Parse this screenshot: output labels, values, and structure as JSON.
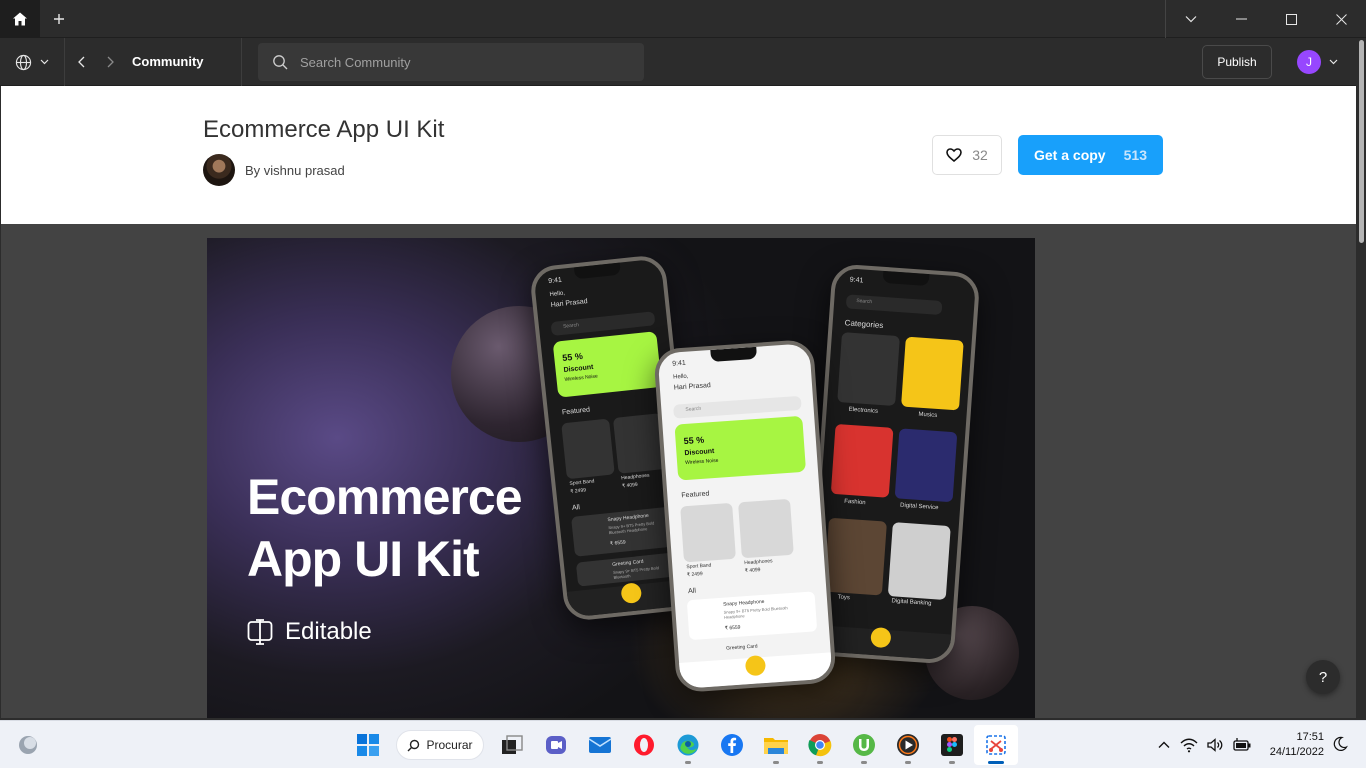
{
  "titlebar": {
    "home_icon": "home-icon",
    "add_tab_icon": "plus-icon",
    "controls": [
      "chevron-down-icon",
      "minimize-icon",
      "maximize-icon",
      "close-icon"
    ]
  },
  "toolbar": {
    "breadcrumb": "Community",
    "search_placeholder": "Search Community",
    "publish_label": "Publish",
    "avatar_initial": "J"
  },
  "file": {
    "title": "Ecommerce App UI Kit",
    "author": "By vishnu prasad",
    "likes": "32",
    "copy_label": "Get a copy",
    "copy_count": "513"
  },
  "hero": {
    "title_line1": "Ecommerce",
    "title_line2": "App UI Kit",
    "editable_label": "Editable",
    "phone1": {
      "time": "9:41",
      "greeting": "Hello,",
      "name": "Hari Prasad",
      "search": "Search",
      "discount_pct": "55 %",
      "discount_label": "Discount",
      "discount_sub": "Wireless Noise",
      "featured": "Featured",
      "item1": "Sport Band",
      "item1_price": "₹ 2499",
      "item2": "Headphones",
      "item2_price": "₹ 4099",
      "all": "All",
      "list1": "Snapy Headphone",
      "list1_desc": "Snapy 9+ BT5 Pretty Bold Bluetooth Headphone",
      "list1_price": "₹ 6559",
      "list2": "Greeting Card",
      "list2_desc": "Snapy 9+ BT5 Pretty Bold Bluetooth"
    },
    "phone2": {
      "time": "9:41",
      "greeting": "Hello,",
      "name": "Hari Prasad",
      "search": "Search",
      "discount_pct": "55 %",
      "discount_label": "Discount",
      "discount_sub": "Wireless Noise",
      "featured": "Featured",
      "item1": "Sport Band",
      "item1_price": "₹ 2499",
      "item2": "Headphones",
      "item2_price": "₹ 4099",
      "all": "All",
      "list1": "Snapy Headphone",
      "list1_desc": "Snapy 9+ BT5 Pretty Bold Bluetooth Headphone",
      "list1_price": "₹ 6559",
      "list2": "Greeting Card"
    },
    "phone3": {
      "time": "9:41",
      "search": "Search",
      "categories": "Categories",
      "cat1": "Electronics",
      "cat2": "Musics",
      "cat3": "Fashion",
      "cat4": "Digital Service",
      "cat5": "Toys",
      "cat6": "Digital Banking"
    }
  },
  "help_label": "?",
  "taskbar": {
    "search_label": "Procurar",
    "apps": [
      "widgets-icon",
      "start-icon",
      "search",
      "task-view-icon",
      "teams-icon",
      "mail-icon",
      "opera-icon",
      "edge-icon",
      "facebook-icon",
      "file-explorer-icon",
      "chrome-icon",
      "utorrent-icon",
      "media-player-icon",
      "figma-icon",
      "snipping-tool-icon"
    ],
    "time": "17:51",
    "date": "24/11/2022"
  },
  "colors": {
    "accent": "#18a0fb",
    "avatar": "#9747ff",
    "dark_ui": "#2c2c2c",
    "banner_green": "#a7f542",
    "fab_yellow": "#f5c518"
  }
}
